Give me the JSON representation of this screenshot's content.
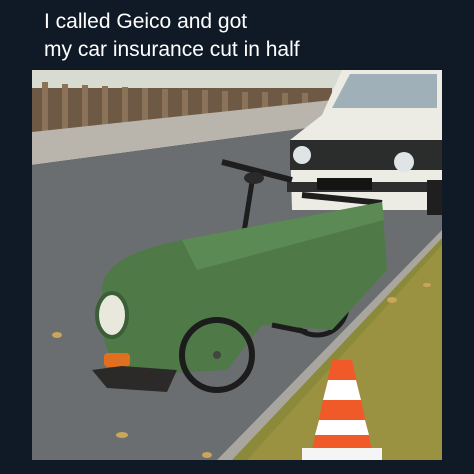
{
  "caption": {
    "line1": "I called Geico and got",
    "line2": "my car insurance cut in half"
  },
  "colors": {
    "background": "#0f1a26",
    "caption_text": "#ffffff",
    "half_car_body": "#4f7a48",
    "white_car": "#ecebe4",
    "road": "#6b6e70",
    "grass": "#8a8a3a",
    "cone_orange": "#f05a28"
  },
  "photo": {
    "description_icons": [
      "half-car-bicycle-icon",
      "white-car-icon",
      "traffic-cone-icon",
      "wooden-fence-icon"
    ]
  }
}
